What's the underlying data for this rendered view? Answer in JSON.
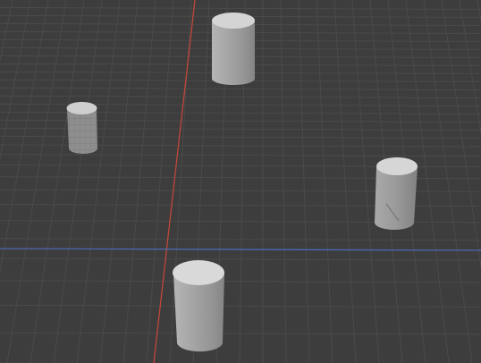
{
  "viewport": {
    "background_color": "#3d3d3d",
    "grid_color": "#4a4a4a",
    "x_axis_color": "#c0473a",
    "y_axis_color": "#4d68b3"
  },
  "objects": [
    {
      "name": "cylinder-top-center",
      "type": "cylinder",
      "selected": false,
      "wireframe": false
    },
    {
      "name": "cylinder-left-wireframe",
      "type": "cylinder",
      "selected": false,
      "wireframe": true
    },
    {
      "name": "cylinder-right",
      "type": "cylinder",
      "selected": false,
      "wireframe": false
    },
    {
      "name": "cylinder-bottom-center",
      "type": "cylinder",
      "selected": false,
      "wireframe": false
    }
  ]
}
